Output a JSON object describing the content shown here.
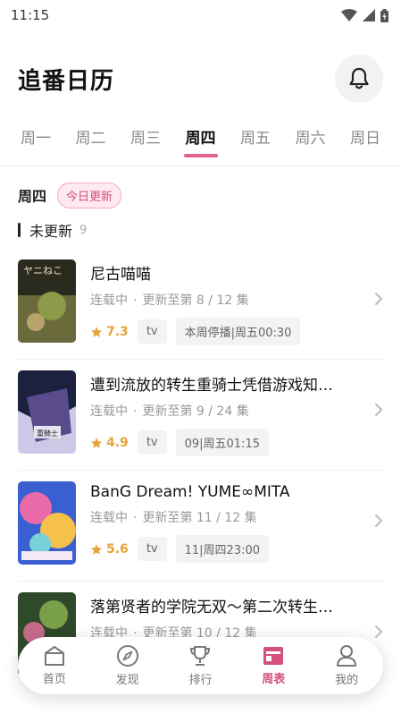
{
  "status_bar": {
    "time": "11:15"
  },
  "header": {
    "title": "追番日历"
  },
  "tabs": [
    {
      "label": "周一",
      "active": false
    },
    {
      "label": "周二",
      "active": false
    },
    {
      "label": "周三",
      "active": false
    },
    {
      "label": "周四",
      "active": true
    },
    {
      "label": "周五",
      "active": false
    },
    {
      "label": "周六",
      "active": false
    },
    {
      "label": "周日",
      "active": false
    }
  ],
  "section": {
    "day": "周四",
    "badge": "今日更新"
  },
  "subsection": {
    "label": "未更新",
    "count": "9"
  },
  "items": [
    {
      "title": "尼古喵喵",
      "status": "连载中",
      "progress": "更新至第 8 / 12 集",
      "rating": "7.3",
      "type": "tv",
      "schedule": "本周停播|周五00:30",
      "poster_colors": [
        "#2b2a1f",
        "#6b6a3c",
        "#8c9a4a"
      ]
    },
    {
      "title": "遭到流放的转生重骑士凭借游戏知…",
      "status": "连载中",
      "progress": "更新至第 9 / 24 集",
      "rating": "4.9",
      "type": "tv",
      "schedule": "09|周五01:15",
      "poster_colors": [
        "#1c2140",
        "#5a4c8c",
        "#cfc7e6"
      ]
    },
    {
      "title": "BanG Dream! YUME∞MITA",
      "status": "连载中",
      "progress": "更新至第 11 / 12 集",
      "rating": "5.6",
      "type": "tv",
      "schedule": "11|周四23:00",
      "poster_colors": [
        "#3a5fd1",
        "#e86aa8",
        "#f5c14a"
      ]
    },
    {
      "title": "落第贤者的学院无双～第二次转生…",
      "status": "连载中",
      "progress": "更新至第 10 / 12 集",
      "rating": "",
      "type": "",
      "schedule": "",
      "poster_colors": [
        "#2e4a2a",
        "#79a049",
        "#c46b8a"
      ]
    }
  ],
  "nav": [
    {
      "label": "首页",
      "icon": "home-icon",
      "active": false
    },
    {
      "label": "发现",
      "icon": "compass-icon",
      "active": false
    },
    {
      "label": "排行",
      "icon": "trophy-icon",
      "active": false
    },
    {
      "label": "周表",
      "icon": "calendar-icon",
      "active": true
    },
    {
      "label": "我的",
      "icon": "profile-icon",
      "active": false
    }
  ],
  "colors": {
    "accent": "#e0638f",
    "rating": "#e8a33a"
  }
}
